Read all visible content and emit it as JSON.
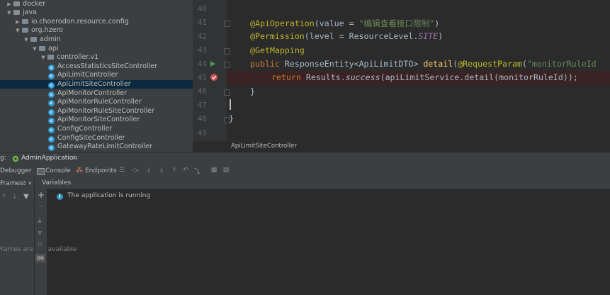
{
  "project_tree": {
    "items": [
      {
        "label": "docker",
        "expanded": false,
        "kind": "folder",
        "depth": 0
      },
      {
        "label": "java",
        "expanded": true,
        "kind": "folder",
        "depth": 0
      },
      {
        "label": "io.choerodon.resource.config",
        "expanded": false,
        "kind": "package",
        "depth": 1
      },
      {
        "label": "org.hzero",
        "expanded": true,
        "kind": "package",
        "depth": 1
      },
      {
        "label": "admin",
        "expanded": true,
        "kind": "package",
        "depth": 2
      },
      {
        "label": "api",
        "expanded": true,
        "kind": "package",
        "depth": 3
      },
      {
        "label": "controller.v1",
        "expanded": true,
        "kind": "package",
        "depth": 4
      },
      {
        "label": "AccessStatisticsSiteController",
        "kind": "class",
        "depth": 5
      },
      {
        "label": "ApiLimitController",
        "kind": "class",
        "depth": 5
      },
      {
        "label": "ApiLimitSiteController",
        "kind": "class",
        "depth": 5,
        "selected": true
      },
      {
        "label": "ApiMonitorController",
        "kind": "class",
        "depth": 5
      },
      {
        "label": "ApiMonitorRuleController",
        "kind": "class",
        "depth": 5
      },
      {
        "label": "ApiMonitorRuleSiteController",
        "kind": "class",
        "depth": 5
      },
      {
        "label": "ApiMonitorSiteController",
        "kind": "class",
        "depth": 5
      },
      {
        "label": "ConfigController",
        "kind": "class",
        "depth": 5
      },
      {
        "label": "ConfigSiteController",
        "kind": "class",
        "depth": 5
      },
      {
        "label": "GatewayRateLimitController",
        "kind": "class",
        "depth": 5
      }
    ]
  },
  "editor": {
    "line_numbers": [
      "40",
      "41",
      "42",
      "43",
      "44",
      "45",
      "46",
      "47",
      "48",
      "49"
    ],
    "lines": {
      "l41_ann": "@ApiOperation",
      "l41_a": "(value = ",
      "l41_str": "\"编辑查看接口限制\"",
      "l41_b": ")",
      "l42_ann": "@Permission",
      "l42_a": "(level = ResourceLevel.",
      "l42_it": "SITE",
      "l42_b": ")",
      "l43_ann": "@GetMapping",
      "l44_kw": "public ",
      "l44_a": "ResponseEntity<ApiLimitDTO> ",
      "l44_fn": "detail",
      "l44_b": "(",
      "l44_ann": "@RequestParam",
      "l44_c": "(",
      "l44_str": "\"monitorRuleId",
      "l45_kw": "return ",
      "l45_a": "Results.",
      "l45_itc": "success",
      "l45_b": "(apiLimitService.detail(monitorRuleId));",
      "l46": "}",
      "l48": "}"
    },
    "breadcrumb": "ApiLimitSiteController"
  },
  "debug": {
    "title_prefix": "g:",
    "run_config": "AdminApplication",
    "tabs": {
      "debugger": "Debugger",
      "console": "Console",
      "endpoints": "Endpoints"
    },
    "frames_header": "Frames:",
    "frames_empty": "Frames are not available",
    "variables_header": "Variables",
    "status_message": "The application is running"
  },
  "colors": {
    "accent_selected": "#0d293e",
    "breakpoint": "#c75450",
    "run_arrow": "#499c54"
  }
}
